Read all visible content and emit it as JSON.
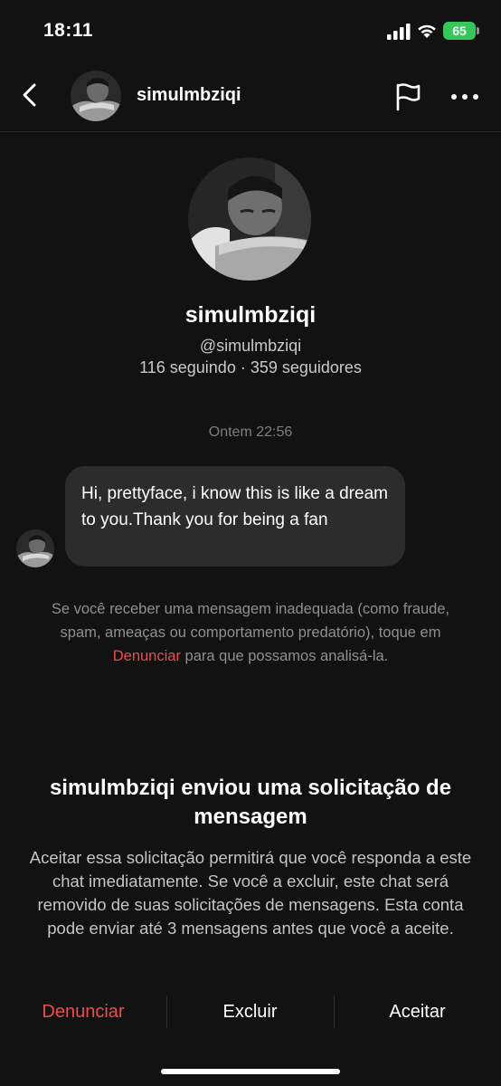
{
  "status_bar": {
    "time": "18:11",
    "battery": "65",
    "icons": [
      "signal-icon",
      "wifi-icon",
      "battery-charging-icon"
    ],
    "battery_color": "#34c759"
  },
  "header": {
    "username": "simulmbziqi",
    "icons": [
      "back-arrow-icon",
      "flag-icon",
      "more-icon"
    ]
  },
  "profile": {
    "name": "simulmbziqi",
    "handle": "@simulmbziqi",
    "stats": "116 seguindo · 359 seguidores"
  },
  "conversation": {
    "timestamp": "Ontem 22:56",
    "messages": [
      {
        "text": "Hi, prettyface, i know this is like a dream to you.Thank you for being a fan"
      }
    ]
  },
  "notice": {
    "text_before": "Se você receber uma mensagem inadequada (como fraude, spam, ameaças ou comportamento predatório), toque em ",
    "link": "Denunciar",
    "text_after": " para que possamos analisá-la."
  },
  "request": {
    "title": "simulmbziqi enviou uma solicitação de mensagem",
    "description": "Aceitar essa solicitação permitirá que você responda a este chat imediatamente. Se você a excluir, este chat será removido de suas solicitações de mensagens. Esta conta pode enviar até 3 mensagens antes que você a aceite."
  },
  "actions": {
    "report": "Denunciar",
    "delete": "Excluir",
    "accept": "Aceitar"
  },
  "colors": {
    "background": "#121212",
    "bubble": "#2c2c2c",
    "danger": "#ed4c4c"
  }
}
